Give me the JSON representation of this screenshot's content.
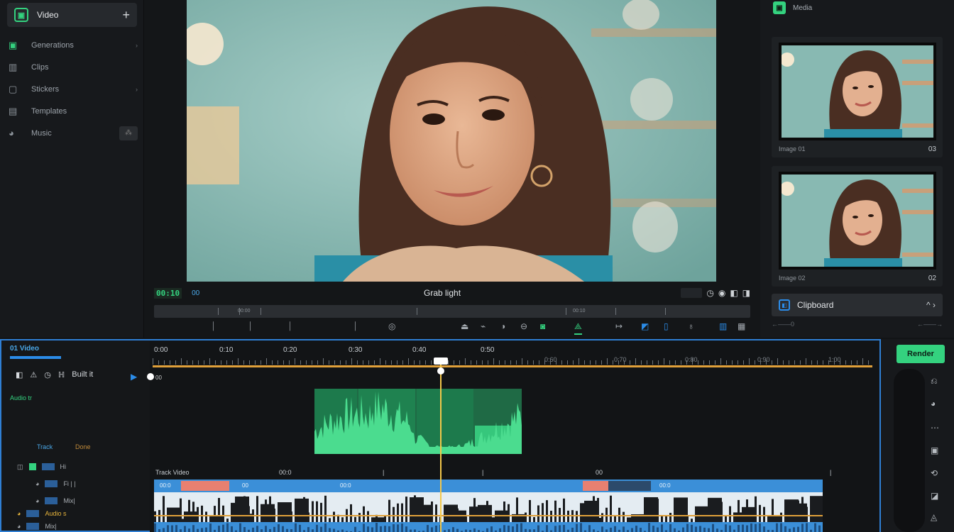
{
  "app": {
    "title": "Video"
  },
  "sidebar": {
    "logo_glyph": "▣",
    "header_title": "Video",
    "plus_glyph": "+",
    "items": [
      {
        "label": "Generations",
        "icon": "▣",
        "icon_name": "frame-icon",
        "chev": "›",
        "green": true
      },
      {
        "label": "Clips",
        "icon": "▥",
        "icon_name": "clips-icon",
        "chev": "",
        "green": false
      },
      {
        "label": "Stickers",
        "icon": "▢",
        "icon_name": "sticker-icon",
        "chev": "›",
        "green": false
      },
      {
        "label": "Templates",
        "icon": "▤",
        "icon_name": "templates-icon",
        "chev": "",
        "green": false
      },
      {
        "label": "Music",
        "icon": "◕",
        "icon_name": "music-icon",
        "chev": "",
        "green": false,
        "badge": "⁂"
      }
    ]
  },
  "preview": {
    "timecode": "00:10",
    "timecode_secondary": "00",
    "center_title": "Grab light",
    "right_icons": [
      "◷",
      "◉",
      "◧",
      "◨"
    ],
    "scrub_labels": [
      "00:00",
      "00:10"
    ],
    "tools": [
      "⏐",
      "⏐",
      "⏐",
      "⏐",
      "◎",
      "⏏",
      "⌁",
      "◑",
      "⊖",
      "◙",
      "⟁",
      "↦",
      "◩",
      "▯",
      "♁",
      "▥",
      "▦"
    ]
  },
  "right_panel": {
    "logo_glyph": "▣",
    "title": "Media",
    "cards": [
      {
        "caption": "Image 01",
        "count": "03"
      },
      {
        "caption": "Image 02",
        "count": "02"
      }
    ],
    "export": {
      "icon": "◧",
      "label": "Clipboard",
      "arrows": "^ ›"
    },
    "footer_left": "←——0",
    "footer_right": "←——→"
  },
  "timeline_left": {
    "header": "01 Video",
    "controls": [
      "◧",
      "⚠",
      "◷",
      "ℍ",
      "Built it"
    ],
    "play": "▶",
    "green_label": "Audio tr",
    "label_blue": "Track",
    "label_orange": "Done",
    "tracks": [
      {
        "icon": "◫",
        "chip": "blue",
        "label": "Hi"
      },
      {
        "icon": "◕",
        "chip": "",
        "label": "Fi   |  |"
      },
      {
        "icon": "◕",
        "chip": "",
        "label": "Mix|"
      },
      {
        "icon": "◕",
        "chip": "yellow",
        "label": "Audio s"
      },
      {
        "icon": "◕",
        "chip": "",
        "label": "Mix|"
      }
    ]
  },
  "timeline": {
    "ruler_major": [
      "0:00",
      "0:10",
      "0:20",
      "0:30",
      "0:40",
      "0:50"
    ],
    "ruler_minor": [
      "0:60",
      "0:70",
      "0:80",
      "0:90",
      "1:00"
    ],
    "start_label": "00",
    "seg_labels": [
      "Track  Video",
      "00:0",
      "|",
      "|",
      "00",
      "|"
    ],
    "vtrack_texts": [
      "00:0",
      "00",
      "00:0",
      "00:0"
    ]
  },
  "timeline_right": {
    "button_label": "Render",
    "icons": [
      "⎌",
      "◕",
      "⋯",
      "▣",
      "⟲",
      "◪",
      "◬"
    ]
  },
  "colors": {
    "accent_green": "#34d27f",
    "accent_blue": "#2f7fd4",
    "playhead": "#f2c74a",
    "orange": "#e0a03a"
  }
}
